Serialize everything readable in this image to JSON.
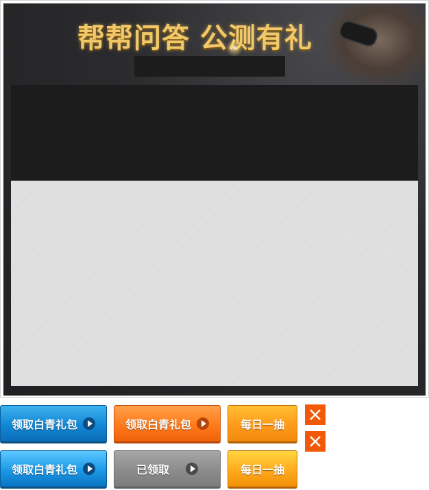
{
  "hero": {
    "title": "帮帮问答 公测有礼"
  },
  "buttons": {
    "claim_gift_blue": "领取白青礼包",
    "claim_gift_orange": "领取白青礼包",
    "daily_draw": "每日一抽",
    "claim_gift_blue_hover": "领取白青礼包",
    "claimed": "已领取",
    "daily_draw_hover": "每日一抽"
  },
  "icons": {
    "play": "play-circle-icon",
    "close": "close-icon"
  },
  "colors": {
    "title_gold": "#f2c96a",
    "blue_button": "#1287d6",
    "orange_button": "#ff7a1a",
    "yellow_button": "#ff9a1b",
    "gray_button": "#8c8c8c",
    "close_button": "#f25a0a"
  }
}
